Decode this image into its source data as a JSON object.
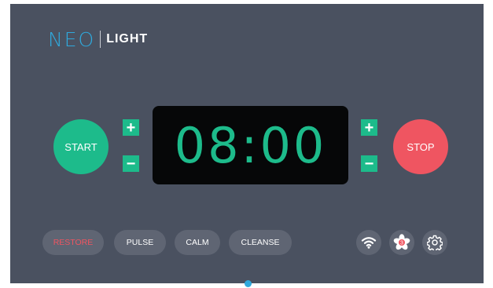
{
  "brand": {
    "primary": "NEO",
    "secondary": "LIGHT"
  },
  "controls": {
    "start_label": "START",
    "stop_label": "STOP",
    "increment_symbol": "+",
    "decrement_symbol": "−"
  },
  "timer": {
    "display": "08:00"
  },
  "modes": [
    {
      "label": "RESTORE",
      "active": true
    },
    {
      "label": "PULSE",
      "active": false
    },
    {
      "label": "CALM",
      "active": false
    },
    {
      "label": "CLEANSE",
      "active": false
    }
  ],
  "status_icons": {
    "wifi": "wifi-icon",
    "fan": "fan-icon",
    "fan_badge": "3",
    "settings": "gear-icon"
  },
  "colors": {
    "background": "#4a5160",
    "accent_green": "#1dbb8b",
    "accent_red": "#ef5561",
    "brand_blue": "#2fa9dd",
    "pill": "#5f6573",
    "timer_bg": "#060708"
  }
}
